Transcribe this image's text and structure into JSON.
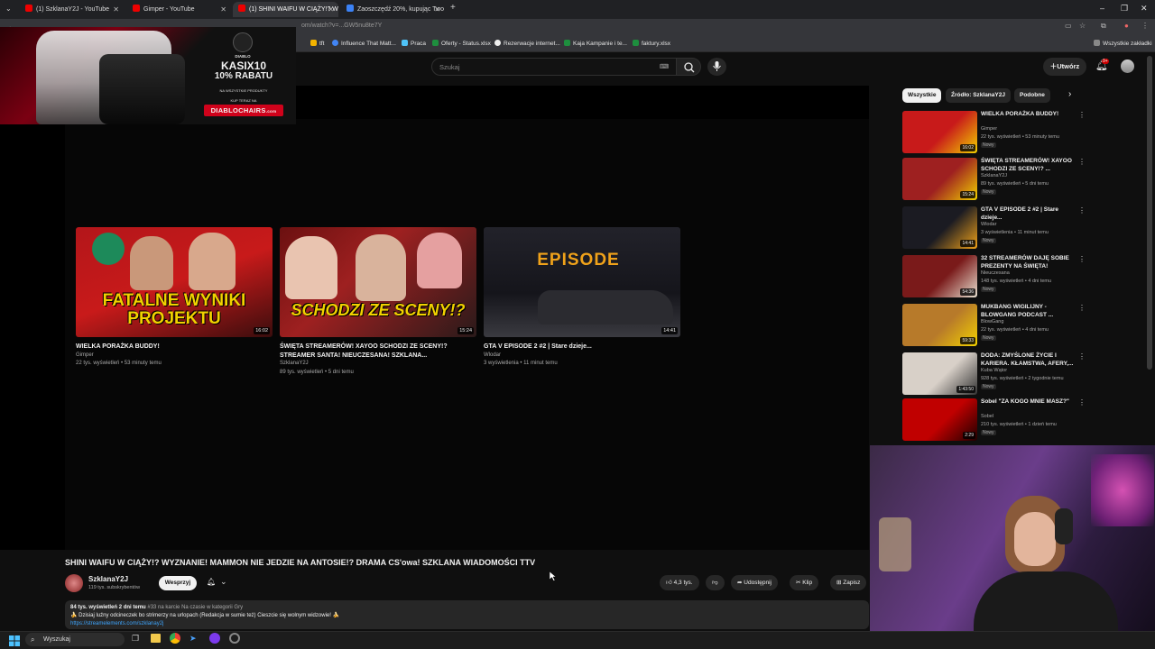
{
  "browser": {
    "tabs": [
      {
        "title": "(1) SzklanaY2J - YouTube",
        "active": false
      },
      {
        "title": "Gimper - YouTube",
        "active": false
      },
      {
        "title": "(1) SHINI WAIFU W CIĄŻY!? W",
        "active": true
      },
      {
        "title": "Zaoszczędź 20%, kupując Two",
        "active": false
      }
    ],
    "url_fragment": "om/watch?v=...GW5nu8te7Y",
    "bookmarks": [
      "tft",
      "Influence That Matt...",
      "Praca",
      "Oferty - Status.xlsx",
      "Rezerwacje internet...",
      "Kaja Kampanie i te...",
      "faktury.xlsx"
    ],
    "all_bookmarks": "Wszystkie zakładki"
  },
  "youtube": {
    "search_placeholder": "Szukaj",
    "create_label": "Utwórz",
    "notifications_count": "9+"
  },
  "ad": {
    "code_line1": "KASIX10",
    "code_line2": "10% RABATU",
    "small_line1": "NA WSZYSTKIE PRODUKTY",
    "small_line2": "KUP TERAZ NA",
    "brand": "DIABLOCHAIRS",
    "brand_suffix": ".com",
    "logo_text": "DIABLO"
  },
  "endscreen": [
    {
      "thumb_text": "FATALNE WYNIKI PROJEKTU",
      "duration": "16:02",
      "title": "WIELKA PORAŻKA BUDDY!",
      "channel": "Gimper",
      "meta": "22 tys. wyświetleń • 53 minuty temu",
      "colors": [
        "#c81a1a",
        "#f2d100"
      ]
    },
    {
      "thumb_text": "SCHODZI ZE SCENY!?",
      "duration": "15:24",
      "title": "ŚWIĘTA STREAMERÓW! XAYOO SCHODZI ZE SCENY!? STREAMER SANTA! NIEUCZESANA! SZKLANA...",
      "channel": "SzklanaY2J",
      "meta": "89 tys. wyświetleń • 5 dni temu",
      "colors": [
        "#9e2020",
        "#f2d100"
      ]
    },
    {
      "thumb_text": "EPISODE",
      "duration": "14:41",
      "title": "GTA V EPISODE 2 #2 | Stare dzieje...",
      "channel": "Wlodar",
      "meta": "3 wyświetlenia • 11 minut temu",
      "colors": [
        "#1b1b22",
        "#f0a21a"
      ]
    }
  ],
  "video": {
    "title": "SHINI WAIFU W CIĄŻY!? WYZNANIE! MAMMON NIE JEDZIE NA ANTOSIE!? DRAMA CS'owa! SZKLANA WIADOMOŚCI TTV",
    "channel": "SzklanaY2J",
    "subscribers": "119 tys. subskrybentów",
    "support_label": "Wesprzyj",
    "likes": "4,3 tys.",
    "share_label": "Udostępnij",
    "clip_label": "Klip",
    "save_label": "Zapisz",
    "views_line": "84 tys. wyświetleń  2 dni temu",
    "trending": "#33 na karcie Na czasie w kategorii Gry",
    "desc_line": "🍌 Dzisiaj luźny odcineczek bo strimerzy na urlopach (Redakcja w sumie też) Cieszcie się wolnym widzowie! 🍌",
    "desc_link": "https://streamelements.com/szklanay2j"
  },
  "sidebar": {
    "chips": [
      "Wszystkie",
      "Źródło: SzklanaY2J",
      "Podobne"
    ],
    "recs": [
      {
        "title": "WIELKA PORAŻKA BUDDY!",
        "channel": "Gimper",
        "meta": "22 tys. wyświetleń • 53 minuty temu",
        "badge": "Nowy",
        "duration": "16:02",
        "colors": [
          "#c81a1a",
          "#f2d100"
        ]
      },
      {
        "title": "ŚWIĘTA STREAMERÓW! XAYOO SCHODZI ZE SCENY!? ...",
        "channel": "SzklanaY2J",
        "meta": "89 tys. wyświetleń • 5 dni temu",
        "badge": "Nowy",
        "duration": "15:24",
        "colors": [
          "#9e2020",
          "#f2d100"
        ]
      },
      {
        "title": "GTA V EPISODE 2 #2 | Stare dzieje...",
        "channel": "Wlodar",
        "meta": "3 wyświetlenia • 11 minut temu",
        "badge": "Nowy",
        "duration": "14:41",
        "colors": [
          "#1b1b22",
          "#f0a21a"
        ]
      },
      {
        "title": "32 STREAMERÓW DAJĘ SOBIE PREZENTY NA ŚWIĘTA!",
        "channel": "Nieuczesana",
        "meta": "148 tys. wyświetleń • 4 dni temu",
        "badge": "Nowy",
        "duration": "54:36",
        "colors": [
          "#7a1a1a",
          "#e8e0d0"
        ]
      },
      {
        "title": "MUKBANG WIGILIJNY - BLOWGANG PODCAST ...",
        "channel": "BlowGang",
        "meta": "22 tys. wyświetleń • 4 dni temu",
        "badge": "Nowy",
        "duration": "59:33",
        "colors": [
          "#b77a2a",
          "#f2d100"
        ]
      },
      {
        "title": "DODA: ZMYŚLONE ŻYCIE I KARIERA. KŁAMSTWA, AFERY,...",
        "channel": "Kuba Wątor",
        "meta": "928 tys. wyświetleń • 2 tygodnie temu",
        "badge": "Nowy",
        "duration": "1:43:50",
        "colors": [
          "#d8d0c8",
          "#333333"
        ]
      },
      {
        "title": "Sobel \"ZA KOGO MNIE MASZ?\"",
        "channel": "Sobel",
        "meta": "210 tys. wyświetleń • 1 dzień temu",
        "badge": "Nowy",
        "duration": "2:29",
        "colors": [
          "#c00000",
          "#200000"
        ]
      }
    ]
  },
  "taskbar": {
    "search_label": "Wyszukaj"
  }
}
